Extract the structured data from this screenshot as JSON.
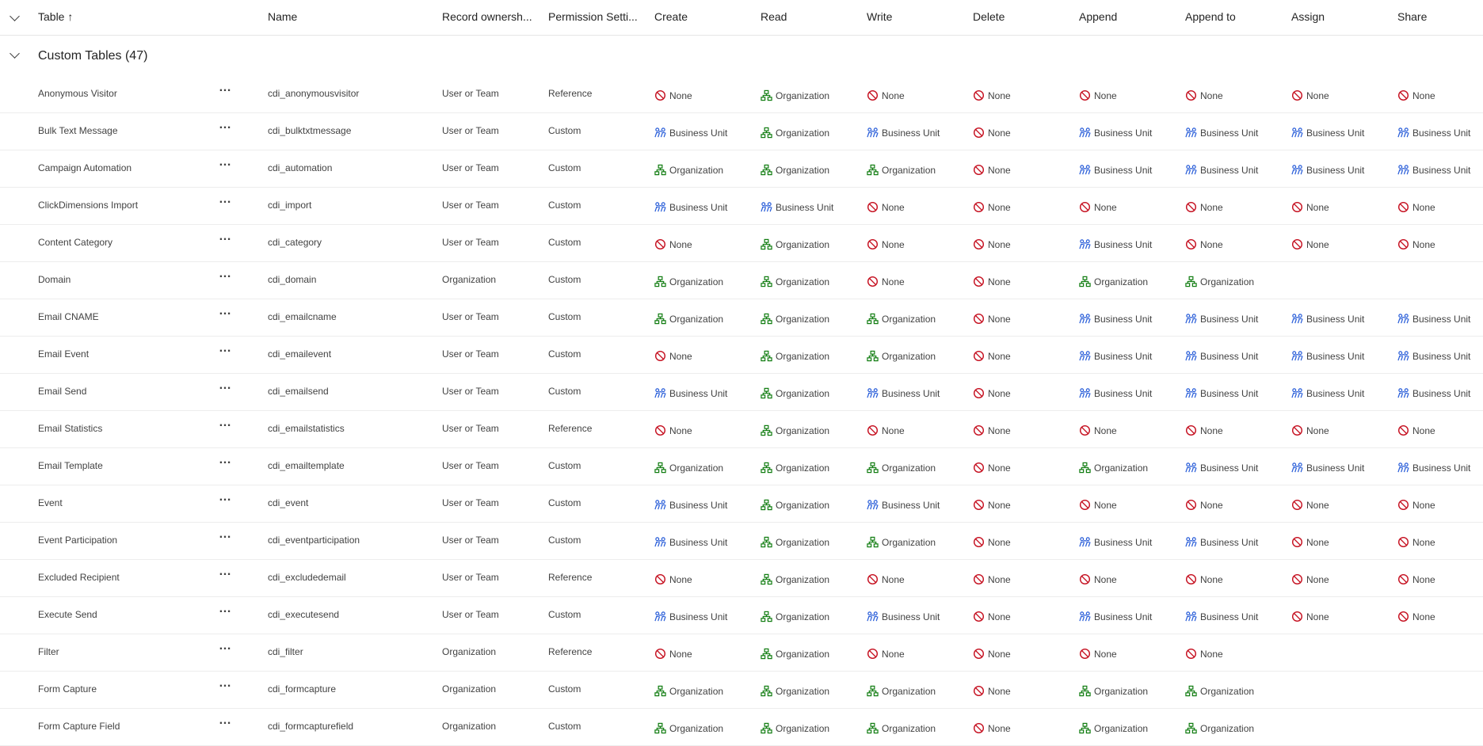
{
  "header": {
    "columns": [
      "Table",
      "Name",
      "Record ownersh...",
      "Permission Setti...",
      "Create",
      "Read",
      "Write",
      "Delete",
      "Append",
      "Append to",
      "Assign",
      "Share"
    ],
    "sort_arrow": "↑"
  },
  "group": {
    "title": "Custom Tables (47)"
  },
  "level_labels": {
    "N": "None",
    "O": "Organization",
    "B": "Business Unit"
  },
  "colors": {
    "none": "#c50f1f",
    "organization": "#107c10",
    "business_unit": "#2b5fd9"
  },
  "rows": [
    {
      "table": "Anonymous Visitor",
      "name": "cdi_anonymousvisitor",
      "ownership": "User or Team",
      "permission": "Reference",
      "access": [
        "None",
        "Organization",
        "None",
        "None",
        "None",
        "None",
        "None",
        "None"
      ]
    },
    {
      "table": "Bulk Text Message",
      "name": "cdi_bulktxtmessage",
      "ownership": "User or Team",
      "permission": "Custom",
      "access": [
        "Business Unit",
        "Organization",
        "Business Unit",
        "None",
        "Business Unit",
        "Business Unit",
        "Business Unit",
        "Business Unit"
      ]
    },
    {
      "table": "Campaign Automation",
      "name": "cdi_automation",
      "ownership": "User or Team",
      "permission": "Custom",
      "access": [
        "Organization",
        "Organization",
        "Organization",
        "None",
        "Business Unit",
        "Business Unit",
        "Business Unit",
        "Business Unit"
      ]
    },
    {
      "table": "ClickDimensions Import",
      "name": "cdi_import",
      "ownership": "User or Team",
      "permission": "Custom",
      "access": [
        "Business Unit",
        "Business Unit",
        "None",
        "None",
        "None",
        "None",
        "None",
        "None"
      ]
    },
    {
      "table": "Content Category",
      "name": "cdi_category",
      "ownership": "User or Team",
      "permission": "Custom",
      "access": [
        "None",
        "Organization",
        "None",
        "None",
        "Business Unit",
        "None",
        "None",
        "None"
      ]
    },
    {
      "table": "Domain",
      "name": "cdi_domain",
      "ownership": "Organization",
      "permission": "Custom",
      "access": [
        "Organization",
        "Organization",
        "None",
        "None",
        "Organization",
        "Organization",
        "",
        ""
      ]
    },
    {
      "table": "Email CNAME",
      "name": "cdi_emailcname",
      "ownership": "User or Team",
      "permission": "Custom",
      "access": [
        "Organization",
        "Organization",
        "Organization",
        "None",
        "Business Unit",
        "Business Unit",
        "Business Unit",
        "Business Unit"
      ]
    },
    {
      "table": "Email Event",
      "name": "cdi_emailevent",
      "ownership": "User or Team",
      "permission": "Custom",
      "access": [
        "None",
        "Organization",
        "Organization",
        "None",
        "Business Unit",
        "Business Unit",
        "Business Unit",
        "Business Unit"
      ]
    },
    {
      "table": "Email Send",
      "name": "cdi_emailsend",
      "ownership": "User or Team",
      "permission": "Custom",
      "access": [
        "Business Unit",
        "Organization",
        "Business Unit",
        "None",
        "Business Unit",
        "Business Unit",
        "Business Unit",
        "Business Unit"
      ]
    },
    {
      "table": "Email Statistics",
      "name": "cdi_emailstatistics",
      "ownership": "User or Team",
      "permission": "Reference",
      "access": [
        "None",
        "Organization",
        "None",
        "None",
        "None",
        "None",
        "None",
        "None"
      ]
    },
    {
      "table": "Email Template",
      "name": "cdi_emailtemplate",
      "ownership": "User or Team",
      "permission": "Custom",
      "access": [
        "Organization",
        "Organization",
        "Organization",
        "None",
        "Organization",
        "Business Unit",
        "Business Unit",
        "Business Unit"
      ]
    },
    {
      "table": "Event",
      "name": "cdi_event",
      "ownership": "User or Team",
      "permission": "Custom",
      "access": [
        "Business Unit",
        "Organization",
        "Business Unit",
        "None",
        "None",
        "None",
        "None",
        "None"
      ]
    },
    {
      "table": "Event Participation",
      "name": "cdi_eventparticipation",
      "ownership": "User or Team",
      "permission": "Custom",
      "access": [
        "Business Unit",
        "Organization",
        "Organization",
        "None",
        "Business Unit",
        "Business Unit",
        "None",
        "None"
      ]
    },
    {
      "table": "Excluded Recipient",
      "name": "cdi_excludedemail",
      "ownership": "User or Team",
      "permission": "Reference",
      "access": [
        "None",
        "Organization",
        "None",
        "None",
        "None",
        "None",
        "None",
        "None"
      ]
    },
    {
      "table": "Execute Send",
      "name": "cdi_executesend",
      "ownership": "User or Team",
      "permission": "Custom",
      "access": [
        "Business Unit",
        "Organization",
        "Business Unit",
        "None",
        "Business Unit",
        "Business Unit",
        "None",
        "None"
      ]
    },
    {
      "table": "Filter",
      "name": "cdi_filter",
      "ownership": "Organization",
      "permission": "Reference",
      "access": [
        "None",
        "Organization",
        "None",
        "None",
        "None",
        "None",
        "",
        ""
      ]
    },
    {
      "table": "Form Capture",
      "name": "cdi_formcapture",
      "ownership": "Organization",
      "permission": "Custom",
      "access": [
        "Organization",
        "Organization",
        "Organization",
        "None",
        "Organization",
        "Organization",
        "",
        ""
      ]
    },
    {
      "table": "Form Capture Field",
      "name": "cdi_formcapturefield",
      "ownership": "Organization",
      "permission": "Custom",
      "access": [
        "Organization",
        "Organization",
        "Organization",
        "None",
        "Organization",
        "Organization",
        "",
        ""
      ]
    }
  ]
}
